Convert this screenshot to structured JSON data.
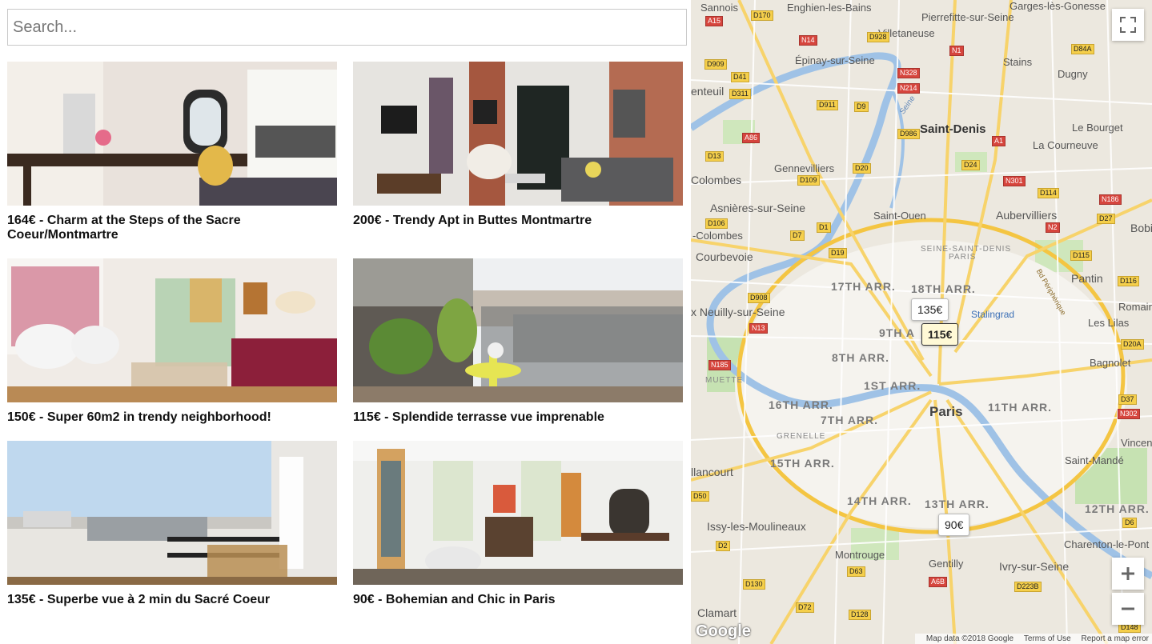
{
  "search": {
    "placeholder": "Search..."
  },
  "listings": [
    {
      "title": "164€ - Charm at the Steps of the Sacre Coeur/Montmartre"
    },
    {
      "title": "200€ - Trendy Apt in Buttes Montmartre"
    },
    {
      "title": "150€ - Super 60m2 in trendy neighborhood!"
    },
    {
      "title": "115€ - Splendide terrasse vue imprenable"
    },
    {
      "title": "135€ - Superbe vue à 2 min du Sacré Coeur"
    },
    {
      "title": "90€ - Bohemian and Chic in Paris"
    }
  ],
  "map": {
    "markers": [
      {
        "label": "135€"
      },
      {
        "label": "115€"
      },
      {
        "label": "90€"
      }
    ],
    "places": [
      "Sannois",
      "Enghien-les-Bains",
      "Pierrefitte-sur-Seine",
      "Garges-lès-Gonesse",
      "Villetaneuse",
      "Épinay-sur-Seine",
      "Stains",
      "Dugny",
      "enteuil",
      "Saint-Denis",
      "Le Bourget",
      "La Courneuve",
      "Gennevilliers",
      "Colombes",
      "Asnières-sur-Seine",
      "Saint-Ouen",
      "Aubervilliers",
      "Bobig",
      "-Colombes",
      "Courbevoie",
      "SEINE-SAINT-DENIS",
      "PARIS",
      "Pantin",
      "Romainvil",
      "Les Lilas",
      "x Neuilly-sur-Seine",
      "Stalingrad",
      "Bagnolet",
      "MUETTE",
      "Paris",
      "GRENELLE",
      "Vincen",
      "Saint-Mandé",
      "llancourt",
      "Issy-les-Moulineaux",
      "Charenton-le-Pont",
      "Montrouge",
      "Gentilly",
      "Ivry-sur-Seine",
      "Clamart",
      "Seine",
      "Bd Périphérique"
    ],
    "arrondissements": [
      "17TH ARR.",
      "18TH ARR.",
      "9TH A",
      "8TH ARR.",
      "1ST ARR.",
      "16TH ARR.",
      "7TH ARR.",
      "11TH ARR.",
      "15TH ARR.",
      "14TH ARR.",
      "13TH ARR.",
      "12TH ARR."
    ],
    "routes": [
      "A15",
      "D170",
      "D928",
      "N14",
      "N1",
      "D84A",
      "D909",
      "N328",
      "D41",
      "N214",
      "D311",
      "D911",
      "D9",
      "D986",
      "A86",
      "A1",
      "D24",
      "D20",
      "N301",
      "D114",
      "N186",
      "D13",
      "D109",
      "D27",
      "D106",
      "D1",
      "N2",
      "D7",
      "D115",
      "D19",
      "D116",
      "D908",
      "D20A",
      "N13",
      "N185",
      "D37",
      "N302",
      "D50",
      "D6",
      "D2",
      "D63",
      "A6B",
      "D223B",
      "D130",
      "D72",
      "D128",
      "D148"
    ],
    "attribution": {
      "map_data": "Map data ©2018 Google",
      "terms": "Terms of Use",
      "report": "Report a map error",
      "logo": "Google"
    }
  }
}
